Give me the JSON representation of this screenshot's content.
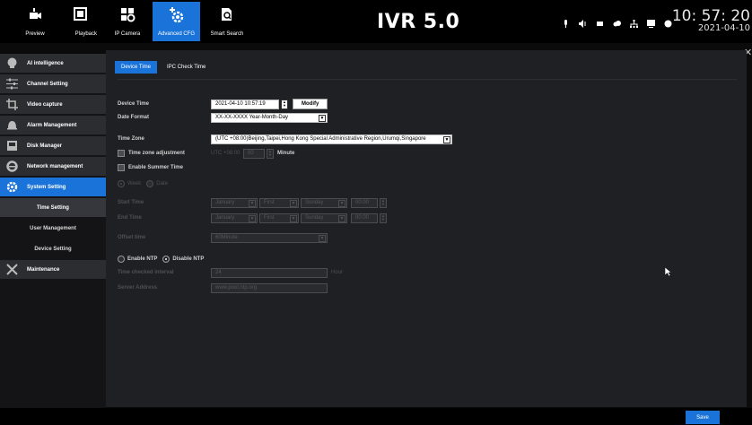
{
  "topbar": {
    "items": [
      {
        "label": "Preview",
        "icon": "preview-icon"
      },
      {
        "label": "Playback",
        "icon": "playback-icon"
      },
      {
        "label": "IP Camera",
        "icon": "ip-camera-icon"
      },
      {
        "label": "Advanced CFG",
        "icon": "advanced-cfg-icon"
      },
      {
        "label": "Smart Search",
        "icon": "smart-search-icon"
      }
    ],
    "brand": "IVR 5.0",
    "time": "10: 57: 20",
    "date": "2021-04-10"
  },
  "sidebar": {
    "items": [
      {
        "label": "AI intelligence",
        "icon": "ai-brain-icon"
      },
      {
        "label": "Channel Setting",
        "icon": "channel-sliders-icon"
      },
      {
        "label": "Video capture",
        "icon": "video-capture-icon"
      },
      {
        "label": "Alarm Management",
        "icon": "alarm-bell-icon"
      },
      {
        "label": "Disk Manager",
        "icon": "disk-icon"
      },
      {
        "label": "Network management",
        "icon": "network-e-icon"
      },
      {
        "label": "System Setting",
        "icon": "system-gear-icon"
      },
      {
        "label": "Maintenance",
        "icon": "maintenance-wrench-icon"
      }
    ],
    "subitems": [
      "Time Setting",
      "User Management",
      "Device Setting"
    ]
  },
  "tabs": [
    "Device Time",
    "IPC Check Time"
  ],
  "form": {
    "device_time_label": "Device Time",
    "device_time_value": "2021-04-10 10:57:19",
    "modify_label": "Modify",
    "date_format_label": "Date Format",
    "date_format_value": "XX-XX-XXXX Year-Month-Day",
    "time_zone_label": "Time Zone",
    "time_zone_value": "(UTC +08:00)Beijing,Taipei,Hong Kong Special Administrative Region,Urumqi,Singapore",
    "tz_adjust_label": "Time zone adjustment",
    "tz_adjust_prefix": "UTC +08:00",
    "tz_adjust_value": "00",
    "tz_adjust_unit": "Minute",
    "summer_label": "Enable Summer Time",
    "week_label": "Week",
    "date_label": "Date",
    "start_time_label": "Start Time",
    "end_time_label": "End Time",
    "month_value": "January",
    "first_value": "First",
    "sunday_value": "Sunday",
    "time_value": "00:00",
    "offset_label": "Offset time",
    "offset_value": "60Minute",
    "enable_ntp_label": "Enable NTP",
    "disable_ntp_label": "Disable NTP",
    "ntp_interval_label": "Time checked interval",
    "ntp_interval_value": "24",
    "ntp_interval_unit": "Hour",
    "server_label": "Server Address",
    "server_value": "www.pool.ntp.org"
  },
  "footer": {
    "save_label": "Save"
  },
  "colors": {
    "accent": "#1a73d9",
    "background": "#1f2024",
    "sidebar": "#2b2d31"
  }
}
